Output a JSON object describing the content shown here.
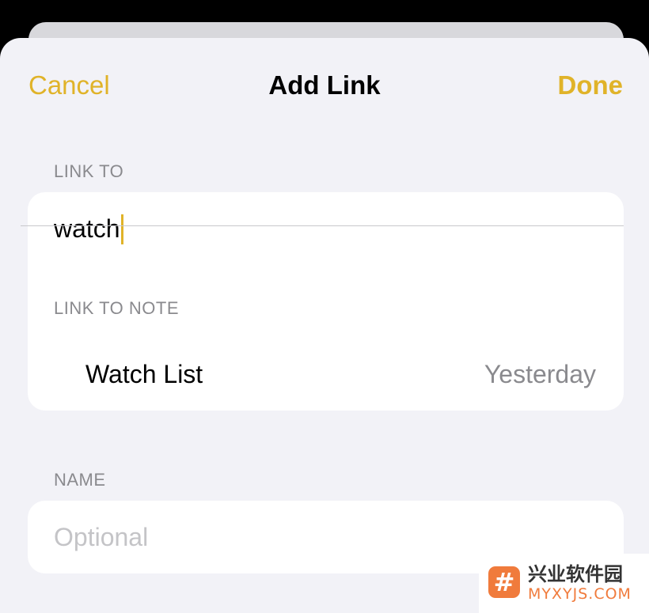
{
  "nav": {
    "cancel_label": "Cancel",
    "title": "Add Link",
    "done_label": "Done"
  },
  "link_to": {
    "section_header": "LINK TO",
    "input_value": "watch",
    "suggestions_header": "LINK TO NOTE",
    "results": [
      {
        "title": "Watch List",
        "date": "Yesterday"
      }
    ]
  },
  "name": {
    "section_header": "NAME",
    "placeholder": "Optional",
    "value": ""
  },
  "watermark": {
    "logo_glyph": "#",
    "brand_text": "兴业软件园",
    "url_text": "MYXYJS.COM"
  },
  "colors": {
    "accent": "#e0b329",
    "background": "#f2f2f7",
    "secondary_text": "#8a8a8e",
    "placeholder": "#c4c4c7"
  }
}
